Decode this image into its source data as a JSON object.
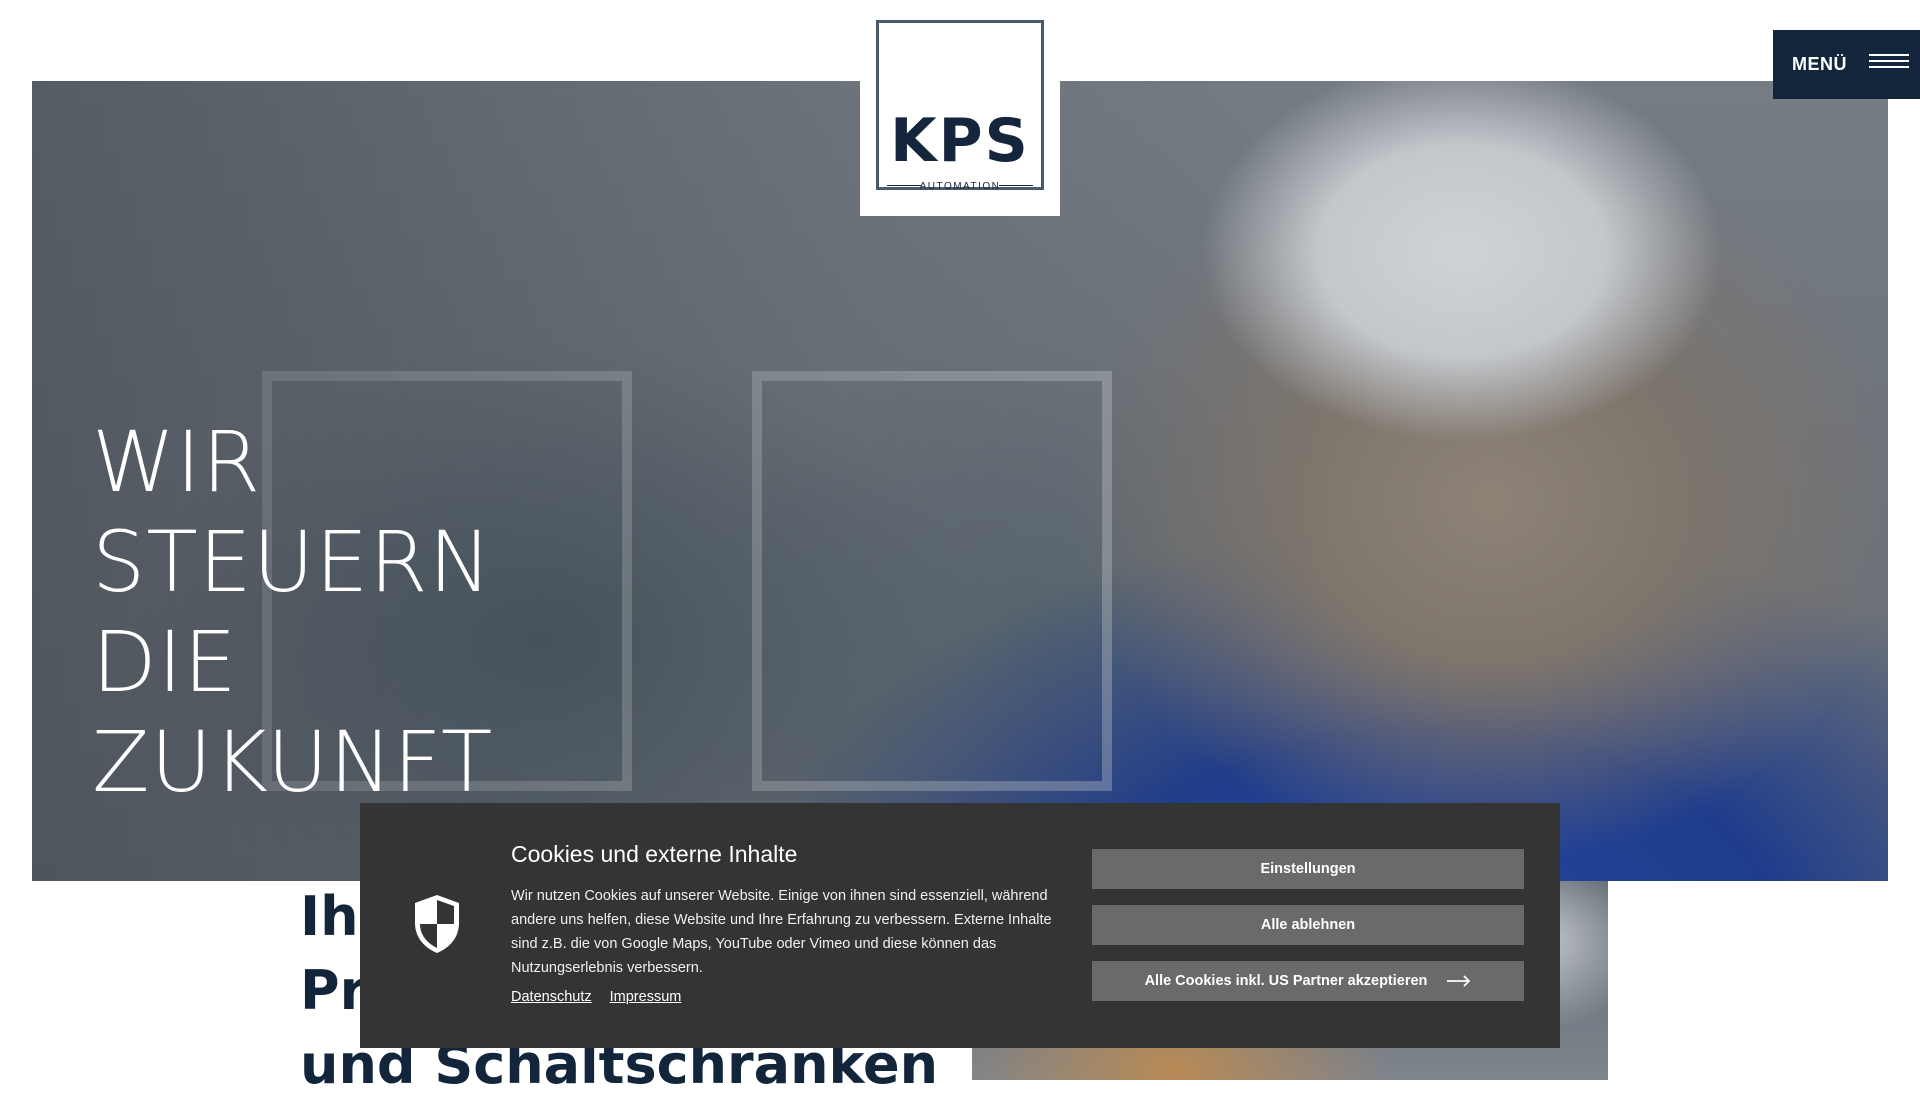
{
  "brand": {
    "logo_main": "KPS",
    "logo_sub": "AUTOMATION"
  },
  "menu": {
    "label": "MENÜ",
    "icon": "hamburger-icon"
  },
  "hero": {
    "headline_lines": [
      "WIR",
      "STEUERN",
      "DIE",
      "ZUKUNFT"
    ]
  },
  "section": {
    "heading_lines": [
      "Ihr",
      "Pr",
      "und Schaltschränken"
    ]
  },
  "cookie_banner": {
    "title": "Cookies und externe Inhalte",
    "text": "Wir nutzen Cookies auf unserer Website. Einige von ihnen sind essenziell, während andere uns helfen, diese Website und Ihre Erfahrung zu verbessern. Externe Inhalte sind z.B. die von Google Maps, YouTube oder Vimeo und diese können das Nutzungserlebnis verbessern.",
    "links": {
      "privacy": "Datenschutz",
      "imprint": "Impressum"
    },
    "buttons": {
      "settings": "Einstellungen",
      "reject_all": "Alle ablehnen",
      "accept_all": "Alle Cookies inkl. US Partner akzeptieren"
    },
    "icon": "shield-icon"
  },
  "colors": {
    "brand_navy": "#13253b",
    "banner_bg": "#343434",
    "button_bg": "#6a6a6a"
  }
}
